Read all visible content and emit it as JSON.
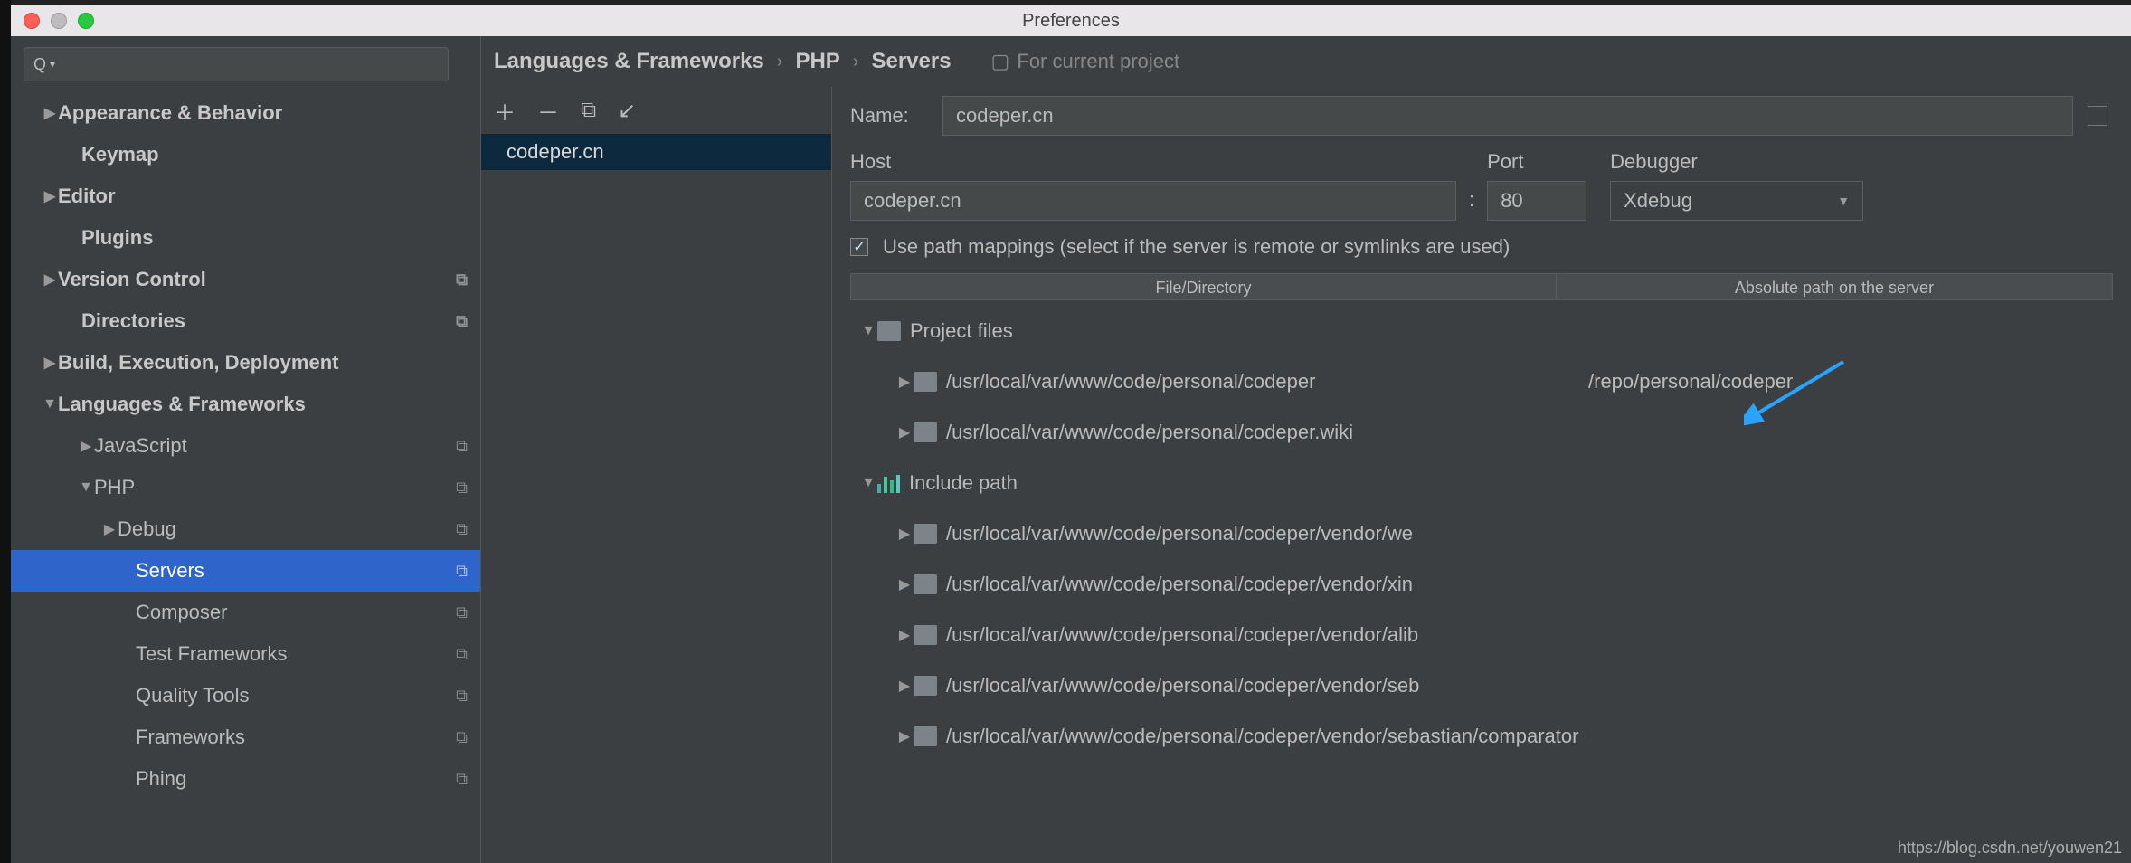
{
  "window_title": "Preferences",
  "search_placeholder": "",
  "breadcrumb": {
    "a": "Languages & Frameworks",
    "b": "PHP",
    "c": "Servers",
    "scope": "For current project"
  },
  "sidebar": [
    {
      "label": "Appearance & Behavior",
      "indent": 34,
      "arrow": "▶",
      "bold": true,
      "copy": false
    },
    {
      "label": "Keymap",
      "indent": 60,
      "arrow": "",
      "bold": true,
      "copy": false
    },
    {
      "label": "Editor",
      "indent": 34,
      "arrow": "▶",
      "bold": true,
      "copy": false
    },
    {
      "label": "Plugins",
      "indent": 60,
      "arrow": "",
      "bold": true,
      "copy": false
    },
    {
      "label": "Version Control",
      "indent": 34,
      "arrow": "▶",
      "bold": true,
      "copy": true
    },
    {
      "label": "Directories",
      "indent": 60,
      "arrow": "",
      "bold": true,
      "copy": true
    },
    {
      "label": "Build, Execution, Deployment",
      "indent": 34,
      "arrow": "▶",
      "bold": true,
      "copy": false
    },
    {
      "label": "Languages & Frameworks",
      "indent": 34,
      "arrow": "▼",
      "bold": true,
      "copy": false
    },
    {
      "label": "JavaScript",
      "indent": 74,
      "arrow": "▶",
      "bold": false,
      "copy": true
    },
    {
      "label": "PHP",
      "indent": 74,
      "arrow": "▼",
      "bold": false,
      "copy": true
    },
    {
      "label": "Debug",
      "indent": 100,
      "arrow": "▶",
      "bold": false,
      "copy": true
    },
    {
      "label": "Servers",
      "indent": 120,
      "arrow": "",
      "bold": false,
      "copy": true,
      "selected": true
    },
    {
      "label": "Composer",
      "indent": 120,
      "arrow": "",
      "bold": false,
      "copy": true
    },
    {
      "label": "Test Frameworks",
      "indent": 120,
      "arrow": "",
      "bold": false,
      "copy": true
    },
    {
      "label": "Quality Tools",
      "indent": 120,
      "arrow": "",
      "bold": false,
      "copy": true
    },
    {
      "label": "Frameworks",
      "indent": 120,
      "arrow": "",
      "bold": false,
      "copy": true
    },
    {
      "label": "Phing",
      "indent": 120,
      "arrow": "",
      "bold": false,
      "copy": true
    }
  ],
  "server_list_selected": "codeper.cn",
  "form": {
    "name_label": "Name:",
    "name_value": "codeper.cn",
    "host_label": "Host",
    "host_value": "codeper.cn",
    "port_label": "Port",
    "port_value": "80",
    "debugger_label": "Debugger",
    "debugger_value": "Xdebug",
    "colon": ":",
    "use_path_label": "Use path mappings (select if the server is remote or symlinks are used)"
  },
  "columns": {
    "c1": "File/Directory",
    "c2": "Absolute path on the server"
  },
  "paths": {
    "project_label": "Project files",
    "include_label": "Include path",
    "rows": [
      {
        "indent": 50,
        "tri": "▶",
        "path": "/usr/local/var/www/code/personal/codeper",
        "abs": "/repo/personal/codeper"
      },
      {
        "indent": 50,
        "tri": "▶",
        "path": "/usr/local/var/www/code/personal/codeper.wiki",
        "abs": ""
      }
    ],
    "includes": [
      {
        "indent": 50,
        "tri": "▶",
        "path": "/usr/local/var/www/code/personal/codeper/vendor/we"
      },
      {
        "indent": 50,
        "tri": "▶",
        "path": "/usr/local/var/www/code/personal/codeper/vendor/xin"
      },
      {
        "indent": 50,
        "tri": "▶",
        "path": "/usr/local/var/www/code/personal/codeper/vendor/alib"
      },
      {
        "indent": 50,
        "tri": "▶",
        "path": "/usr/local/var/www/code/personal/codeper/vendor/seb"
      },
      {
        "indent": 50,
        "tri": "▶",
        "path": "/usr/local/var/www/code/personal/codeper/vendor/sebastian/comparator"
      }
    ]
  },
  "watermark": "https://blog.csdn.net/youwen21"
}
